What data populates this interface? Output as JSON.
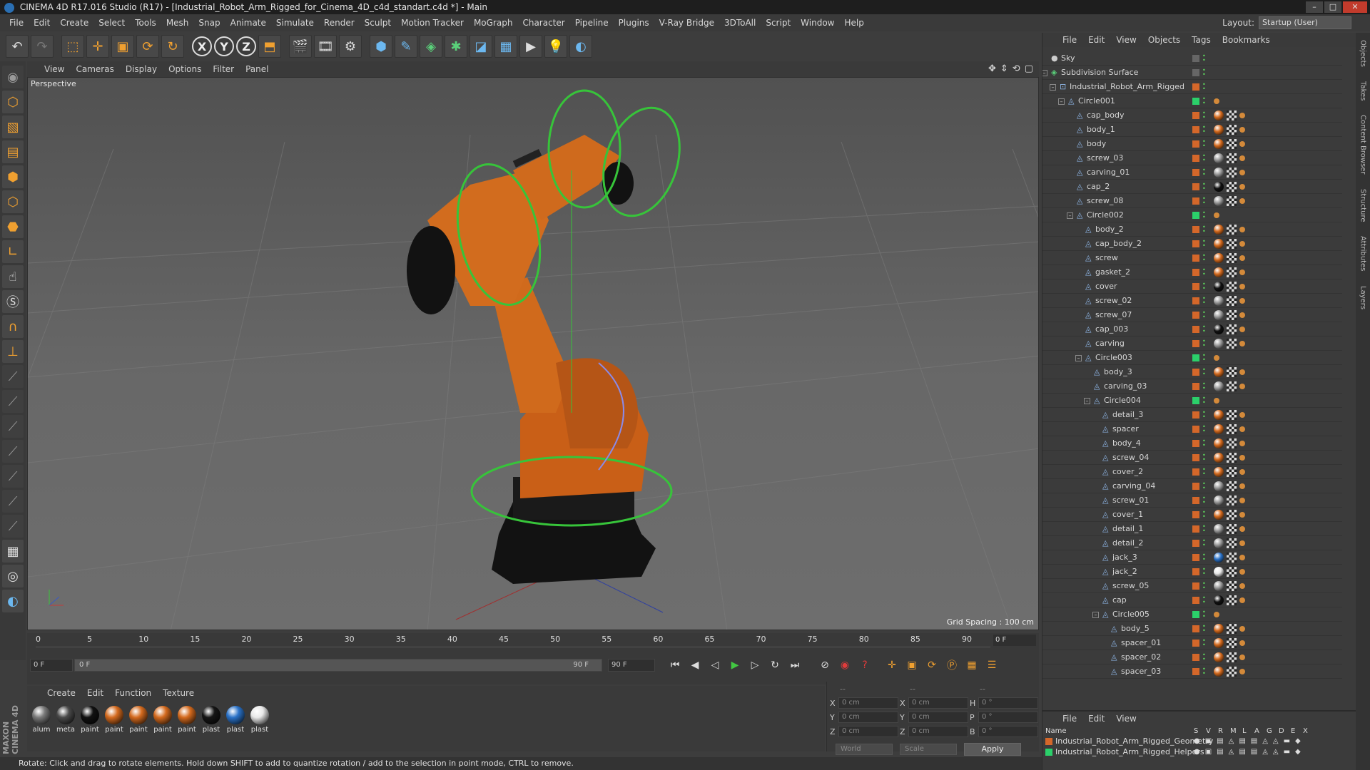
{
  "window": {
    "title": "CINEMA 4D R17.016 Studio (R17) - [Industrial_Robot_Arm_Rigged_for_Cinema_4D_c4d_standart.c4d *] - Main"
  },
  "menu": [
    "File",
    "Edit",
    "Create",
    "Select",
    "Tools",
    "Mesh",
    "Snap",
    "Animate",
    "Simulate",
    "Render",
    "Sculpt",
    "Motion Tracker",
    "MoGraph",
    "Character",
    "Pipeline",
    "Plugins",
    "V-Ray Bridge",
    "3DToAll",
    "Script",
    "Window",
    "Help"
  ],
  "layout": {
    "label": "Layout:",
    "value": "Startup (User)"
  },
  "viewport": {
    "menu": [
      "View",
      "Cameras",
      "Display",
      "Options",
      "Filter",
      "Panel"
    ],
    "label": "Perspective",
    "grid_spacing": "Grid Spacing : 100 cm"
  },
  "timeline": {
    "ticks": [
      "0",
      "5",
      "10",
      "15",
      "20",
      "25",
      "30",
      "35",
      "40",
      "45",
      "50",
      "55",
      "60",
      "65",
      "70",
      "75",
      "80",
      "85",
      "90"
    ],
    "current_frame": "0 F",
    "start": "0 F",
    "range_start": "0 F",
    "range_end": "90 F",
    "end": "90 F"
  },
  "material_manager": {
    "menu": [
      "Create",
      "Edit",
      "Function",
      "Texture"
    ],
    "materials": [
      {
        "label": "alum",
        "color": "#7a7a7a"
      },
      {
        "label": "meta",
        "color": "#4a4a4a"
      },
      {
        "label": "paint",
        "color": "#111111"
      },
      {
        "label": "paint",
        "color": "#d46a1e"
      },
      {
        "label": "paint",
        "color": "#d46a1e"
      },
      {
        "label": "paint",
        "color": "#d46a1e"
      },
      {
        "label": "paint",
        "color": "#d46a1e"
      },
      {
        "label": "plast",
        "color": "#151515"
      },
      {
        "label": "plast",
        "color": "#2a72c8"
      },
      {
        "label": "plast",
        "color": "#e8e8e8"
      }
    ]
  },
  "coordinates": {
    "header": [
      "--",
      "--",
      "--"
    ],
    "rows": [
      {
        "a": "X",
        "av": "0 cm",
        "b": "X",
        "bv": "0 cm",
        "c": "H",
        "cv": "0 °"
      },
      {
        "a": "Y",
        "av": "0 cm",
        "b": "Y",
        "bv": "0 cm",
        "c": "P",
        "cv": "0 °"
      },
      {
        "a": "Z",
        "av": "0 cm",
        "b": "Z",
        "bv": "0 cm",
        "c": "B",
        "cv": "0 °"
      }
    ],
    "mode": "World",
    "scale": "Scale",
    "apply": "Apply"
  },
  "status": "Rotate: Click and drag to rotate elements. Hold down SHIFT to add to quantize rotation / add to the selection in point mode, CTRL to remove.",
  "maxon": "MAXON CINEMA 4D",
  "object_manager": {
    "menu": [
      "File",
      "Edit",
      "View",
      "Objects",
      "Tags",
      "Bookmarks"
    ],
    "objects": [
      {
        "name": "Sky",
        "depth": 0,
        "kind": "sky",
        "tags": "none"
      },
      {
        "name": "Subdivision Surface",
        "depth": 0,
        "kind": "sds",
        "tags": "none"
      },
      {
        "name": "Industrial_Robot_Arm_Rigged",
        "depth": 1,
        "kind": "null",
        "tags": "none"
      },
      {
        "name": "Circle001",
        "depth": 2,
        "kind": "spline",
        "tags": "dot"
      },
      {
        "name": "cap_body",
        "depth": 3,
        "kind": "poly",
        "tags": "orange"
      },
      {
        "name": "body_1",
        "depth": 3,
        "kind": "poly",
        "tags": "orange"
      },
      {
        "name": "body",
        "depth": 3,
        "kind": "poly",
        "tags": "orange"
      },
      {
        "name": "screw_03",
        "depth": 3,
        "kind": "poly",
        "tags": "grey"
      },
      {
        "name": "carving_01",
        "depth": 3,
        "kind": "poly",
        "tags": "grey"
      },
      {
        "name": "cap_2",
        "depth": 3,
        "kind": "poly",
        "tags": "black"
      },
      {
        "name": "screw_08",
        "depth": 3,
        "kind": "poly",
        "tags": "grey"
      },
      {
        "name": "Circle002",
        "depth": 3,
        "kind": "spline",
        "tags": "dot"
      },
      {
        "name": "body_2",
        "depth": 4,
        "kind": "poly",
        "tags": "orange"
      },
      {
        "name": "cap_body_2",
        "depth": 4,
        "kind": "poly",
        "tags": "orange"
      },
      {
        "name": "screw",
        "depth": 4,
        "kind": "poly",
        "tags": "orange"
      },
      {
        "name": "gasket_2",
        "depth": 4,
        "kind": "poly",
        "tags": "orange"
      },
      {
        "name": "cover",
        "depth": 4,
        "kind": "poly",
        "tags": "black"
      },
      {
        "name": "screw_02",
        "depth": 4,
        "kind": "poly",
        "tags": "grey"
      },
      {
        "name": "screw_07",
        "depth": 4,
        "kind": "poly",
        "tags": "grey"
      },
      {
        "name": "cap_003",
        "depth": 4,
        "kind": "poly",
        "tags": "black"
      },
      {
        "name": "carving",
        "depth": 4,
        "kind": "poly",
        "tags": "grey"
      },
      {
        "name": "Circle003",
        "depth": 4,
        "kind": "spline",
        "tags": "dot"
      },
      {
        "name": "body_3",
        "depth": 5,
        "kind": "poly",
        "tags": "orange"
      },
      {
        "name": "carving_03",
        "depth": 5,
        "kind": "poly",
        "tags": "grey"
      },
      {
        "name": "Circle004",
        "depth": 5,
        "kind": "spline",
        "tags": "dot"
      },
      {
        "name": "detail_3",
        "depth": 6,
        "kind": "poly",
        "tags": "orange"
      },
      {
        "name": "spacer",
        "depth": 6,
        "kind": "poly",
        "tags": "orange"
      },
      {
        "name": "body_4",
        "depth": 6,
        "kind": "poly",
        "tags": "orange"
      },
      {
        "name": "screw_04",
        "depth": 6,
        "kind": "poly",
        "tags": "orange"
      },
      {
        "name": "cover_2",
        "depth": 6,
        "kind": "poly",
        "tags": "orange"
      },
      {
        "name": "carving_04",
        "depth": 6,
        "kind": "poly",
        "tags": "grey"
      },
      {
        "name": "screw_01",
        "depth": 6,
        "kind": "poly",
        "tags": "grey"
      },
      {
        "name": "cover_1",
        "depth": 6,
        "kind": "poly",
        "tags": "orange"
      },
      {
        "name": "detail_1",
        "depth": 6,
        "kind": "poly",
        "tags": "grey"
      },
      {
        "name": "detail_2",
        "depth": 6,
        "kind": "poly",
        "tags": "grey"
      },
      {
        "name": "jack_3",
        "depth": 6,
        "kind": "poly",
        "tags": "blue"
      },
      {
        "name": "jack_2",
        "depth": 6,
        "kind": "poly",
        "tags": "white"
      },
      {
        "name": "screw_05",
        "depth": 6,
        "kind": "poly",
        "tags": "grey"
      },
      {
        "name": "cap",
        "depth": 6,
        "kind": "poly",
        "tags": "black"
      },
      {
        "name": "Circle005",
        "depth": 6,
        "kind": "spline",
        "tags": "dot"
      },
      {
        "name": "body_5",
        "depth": 7,
        "kind": "poly",
        "tags": "orange"
      },
      {
        "name": "spacer_01",
        "depth": 7,
        "kind": "poly",
        "tags": "orange"
      },
      {
        "name": "spacer_02",
        "depth": 7,
        "kind": "poly",
        "tags": "orange"
      },
      {
        "name": "spacer_03",
        "depth": 7,
        "kind": "poly",
        "tags": "orange"
      }
    ]
  },
  "layer_manager": {
    "menu": [
      "File",
      "Edit",
      "View"
    ],
    "columns": [
      "Name",
      "S",
      "V",
      "R",
      "M",
      "L",
      "A",
      "G",
      "D",
      "E",
      "X"
    ],
    "layers": [
      {
        "name": "Industrial_Robot_Arm_Rigged_Geometry",
        "color": "#d4672a"
      },
      {
        "name": "Industrial_Robot_Arm_Rigged_Helpers",
        "color": "#2bd06a"
      }
    ]
  },
  "side_tabs": [
    "Objects",
    "Takes",
    "Content Browser",
    "Structure",
    "Attributes",
    "Layers"
  ]
}
